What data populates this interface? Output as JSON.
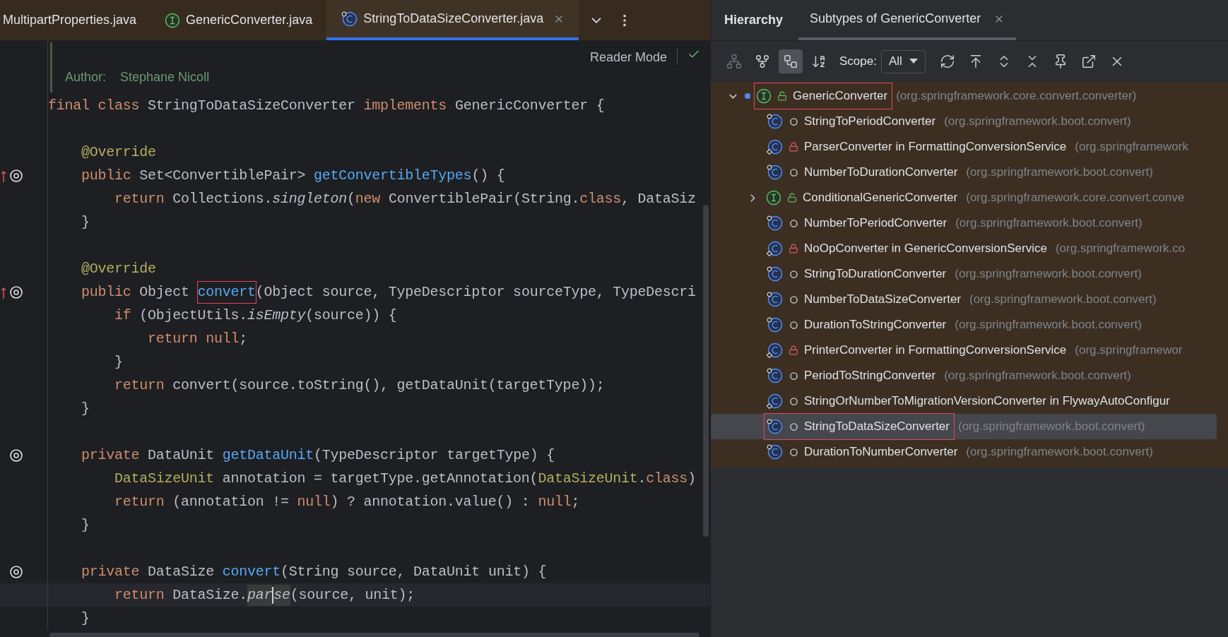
{
  "editor_tabs": [
    {
      "label": "MultipartProperties.java",
      "kind": "plain",
      "selected": false,
      "closable": false
    },
    {
      "label": "GenericConverter.java",
      "kind": "interface",
      "selected": false,
      "closable": false
    },
    {
      "label": "StringToDataSizeConverter.java",
      "kind": "class",
      "selected": true,
      "closable": true
    }
  ],
  "doc": {
    "label": "Author:",
    "value": "Stephane Nicoll"
  },
  "reader_mode": "Reader Mode",
  "code_lines": [
    {
      "tokens": [
        {
          "text": "final class ",
          "kind": "keyword"
        },
        {
          "text": "StringToDataSizeConverter ",
          "kind": "plain"
        },
        {
          "text": "implements ",
          "kind": "keyword"
        },
        {
          "text": "GenericConverter {",
          "kind": "plain"
        }
      ]
    },
    {
      "blank_before": true,
      "tokens": [
        {
          "text": "    @Override",
          "kind": "annotation"
        }
      ]
    },
    {
      "gutter": {
        "kind": "override"
      },
      "tokens": [
        {
          "text": "    public ",
          "kind": "keyword"
        },
        {
          "text": "Set<ConvertiblePair> ",
          "kind": "plain"
        },
        {
          "text": "getConvertibleTypes",
          "kind": "declaration"
        },
        {
          "text": "() {",
          "kind": "plain"
        }
      ]
    },
    {
      "tokens": [
        {
          "text": "        return ",
          "kind": "keyword"
        },
        {
          "text": "Collections.",
          "kind": "plain"
        },
        {
          "text": "singleton",
          "kind": "italic"
        },
        {
          "text": "(",
          "kind": "plain"
        },
        {
          "text": "new ",
          "kind": "keyword"
        },
        {
          "text": "ConvertiblePair(String.",
          "kind": "plain"
        },
        {
          "text": "class",
          "kind": "keyword"
        },
        {
          "text": ", DataSiz",
          "kind": "plain"
        }
      ]
    },
    {
      "tokens": [
        {
          "text": "    }",
          "kind": "plain"
        }
      ]
    },
    {
      "blank_before": true,
      "tokens": [
        {
          "text": "    @Override",
          "kind": "annotation"
        }
      ]
    },
    {
      "gutter": {
        "kind": "override"
      },
      "tokens": [
        {
          "text": "    public ",
          "kind": "keyword"
        },
        {
          "text": "Object ",
          "kind": "plain"
        },
        {
          "text": "convert",
          "kind": "declaration",
          "boxed": true
        },
        {
          "text": "(Object source, TypeDescriptor sourceType, TypeDescri",
          "kind": "plain"
        }
      ]
    },
    {
      "tokens": [
        {
          "text": "        if ",
          "kind": "keyword"
        },
        {
          "text": "(ObjectUtils.",
          "kind": "plain"
        },
        {
          "text": "isEmpty",
          "kind": "italic"
        },
        {
          "text": "(source)) {",
          "kind": "plain"
        }
      ]
    },
    {
      "tokens": [
        {
          "text": "            return null",
          "kind": "keyword"
        },
        {
          "text": ";",
          "kind": "plain"
        }
      ]
    },
    {
      "tokens": [
        {
          "text": "        }",
          "kind": "plain"
        }
      ]
    },
    {
      "tokens": [
        {
          "text": "        return ",
          "kind": "keyword"
        },
        {
          "text": "convert(source.toString(), getDataUnit(targetType));",
          "kind": "plain"
        }
      ]
    },
    {
      "tokens": [
        {
          "text": "    }",
          "kind": "plain"
        }
      ]
    },
    {
      "blank_before": true,
      "gutter": {
        "kind": "related"
      },
      "tokens": [
        {
          "text": "    private ",
          "kind": "keyword"
        },
        {
          "text": "DataUnit ",
          "kind": "plain"
        },
        {
          "text": "getDataUnit",
          "kind": "declaration"
        },
        {
          "text": "(TypeDescriptor targetType) {",
          "kind": "plain"
        }
      ]
    },
    {
      "tokens": [
        {
          "text": "        DataSizeUnit",
          "kind": "annotation"
        },
        {
          "text": " annotation = targetType.getAnnotation(",
          "kind": "plain"
        },
        {
          "text": "DataSizeUnit",
          "kind": "annotation"
        },
        {
          "text": ".",
          "kind": "plain"
        },
        {
          "text": "class",
          "kind": "keyword"
        },
        {
          "text": ")",
          "kind": "plain"
        }
      ]
    },
    {
      "tokens": [
        {
          "text": "        return ",
          "kind": "keyword"
        },
        {
          "text": "(annotation != ",
          "kind": "plain"
        },
        {
          "text": "null",
          "kind": "keyword"
        },
        {
          "text": ") ? annotation.value() : ",
          "kind": "plain"
        },
        {
          "text": "null",
          "kind": "keyword"
        },
        {
          "text": ";",
          "kind": "plain"
        }
      ]
    },
    {
      "tokens": [
        {
          "text": "    }",
          "kind": "plain"
        }
      ]
    },
    {
      "blank_before": true,
      "gutter": {
        "kind": "related"
      },
      "tokens": [
        {
          "text": "    private ",
          "kind": "keyword"
        },
        {
          "text": "DataSize ",
          "kind": "plain"
        },
        {
          "text": "convert",
          "kind": "declaration"
        },
        {
          "text": "(String source, DataUnit unit) {",
          "kind": "plain"
        }
      ]
    },
    {
      "current": true,
      "tokens": [
        {
          "text": "        return ",
          "kind": "keyword"
        },
        {
          "text": "DataSize.",
          "kind": "plain"
        },
        {
          "text": "par",
          "kind": "italic",
          "marked": true,
          "caret": true
        },
        {
          "text": "se",
          "kind": "italic",
          "marked": true
        },
        {
          "text": "(source, unit);",
          "kind": "plain"
        }
      ]
    },
    {
      "tokens": [
        {
          "text": "    }",
          "kind": "plain"
        }
      ]
    }
  ],
  "hierarchy": {
    "title": "Hierarchy",
    "tabs": [
      {
        "label": "Subtypes of GenericConverter",
        "selected": true
      }
    ],
    "left_buttons": [
      {
        "kind": "type-hierarchy",
        "disabled": true,
        "selected": false
      },
      {
        "kind": "supertypes",
        "disabled": false,
        "selected": false
      },
      {
        "kind": "subtypes",
        "disabled": false,
        "selected": true
      },
      {
        "kind": "sort",
        "disabled": false,
        "selected": false
      }
    ],
    "scope": {
      "label": "Scope:",
      "value": "All"
    },
    "right_buttons": [
      {
        "kind": "refresh",
        "disabled": false,
        "selected": false
      },
      {
        "kind": "to-top",
        "disabled": false,
        "selected": false
      },
      {
        "kind": "expand",
        "disabled": false,
        "selected": false
      },
      {
        "kind": "collapse",
        "disabled": false,
        "selected": false
      },
      {
        "kind": "pin",
        "disabled": false,
        "selected": false
      },
      {
        "kind": "open",
        "disabled": false,
        "selected": false
      },
      {
        "kind": "close",
        "disabled": false,
        "selected": false
      }
    ],
    "tree": [
      {
        "name": "GenericConverter",
        "package": "(org.springframework.core.convert.converter)",
        "kind": "interface",
        "modifier": {
          "kind": "public"
        },
        "expanded": true,
        "current": true,
        "selected": false,
        "boxed": true,
        "children": [
          {
            "name": "StringToPeriodConverter",
            "package": "(org.springframework.boot.convert)",
            "kind": "class",
            "modifier": {
              "kind": "package"
            },
            "current": false,
            "selected": false,
            "boxed": false
          },
          {
            "name": "ParserConverter in FormattingConversionService",
            "package": "(org.springframework",
            "kind": "inner-class",
            "modifier": {
              "kind": "private"
            },
            "current": false,
            "selected": false,
            "boxed": false
          },
          {
            "name": "NumberToDurationConverter",
            "package": "(org.springframework.boot.convert)",
            "kind": "class",
            "modifier": {
              "kind": "package"
            },
            "current": false,
            "selected": false,
            "boxed": false
          },
          {
            "name": "ConditionalGenericConverter",
            "package": "(org.springframework.core.convert.conve",
            "kind": "interface",
            "modifier": {
              "kind": "public"
            },
            "expanded": false,
            "current": false,
            "selected": false,
            "boxed": false
          },
          {
            "name": "NumberToPeriodConverter",
            "package": "(org.springframework.boot.convert)",
            "kind": "class",
            "modifier": {
              "kind": "package"
            },
            "current": false,
            "selected": false,
            "boxed": false
          },
          {
            "name": "NoOpConverter in GenericConversionService",
            "package": "(org.springframework.co",
            "kind": "inner-class",
            "modifier": {
              "kind": "private"
            },
            "current": false,
            "selected": false,
            "boxed": false
          },
          {
            "name": "StringToDurationConverter",
            "package": "(org.springframework.boot.convert)",
            "kind": "class",
            "modifier": {
              "kind": "package"
            },
            "current": false,
            "selected": false,
            "boxed": false
          },
          {
            "name": "NumberToDataSizeConverter",
            "package": "(org.springframework.boot.convert)",
            "kind": "class",
            "modifier": {
              "kind": "package"
            },
            "current": false,
            "selected": false,
            "boxed": false
          },
          {
            "name": "DurationToStringConverter",
            "package": "(org.springframework.boot.convert)",
            "kind": "class",
            "modifier": {
              "kind": "package"
            },
            "current": false,
            "selected": false,
            "boxed": false
          },
          {
            "name": "PrinterConverter in FormattingConversionService",
            "package": "(org.springframewor",
            "kind": "inner-class",
            "modifier": {
              "kind": "private"
            },
            "current": false,
            "selected": false,
            "boxed": false
          },
          {
            "name": "PeriodToStringConverter",
            "package": "(org.springframework.boot.convert)",
            "kind": "class",
            "modifier": {
              "kind": "package"
            },
            "current": false,
            "selected": false,
            "boxed": false
          },
          {
            "name": "StringOrNumberToMigrationVersionConverter in FlywayAutoConfigur",
            "kind": "inner-class",
            "modifier": {
              "kind": "package"
            },
            "current": false,
            "selected": false,
            "boxed": false
          },
          {
            "name": "StringToDataSizeConverter",
            "package": "(org.springframework.boot.convert)",
            "kind": "class",
            "modifier": {
              "kind": "package"
            },
            "current": false,
            "selected": true,
            "boxed": true
          },
          {
            "name": "DurationToNumberConverter",
            "package": "(org.springframework.boot.convert)",
            "kind": "class",
            "modifier": {
              "kind": "package"
            },
            "current": false,
            "selected": false,
            "boxed": false
          }
        ]
      }
    ]
  }
}
